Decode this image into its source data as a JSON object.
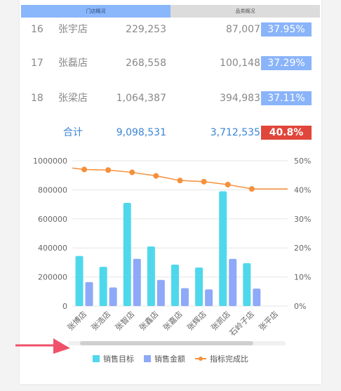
{
  "tabs": [
    "门店概况",
    "品类概况"
  ],
  "rows": [
    {
      "rank": "16",
      "name": "张宇店",
      "target": "229,253",
      "amount": "87,007",
      "pct": "37.95%"
    },
    {
      "rank": "17",
      "name": "张磊店",
      "target": "268,558",
      "amount": "100,148",
      "pct": "37.29%"
    },
    {
      "rank": "18",
      "name": "张梁店",
      "target": "1,064,387",
      "amount": "394,983",
      "pct": "37.11%"
    }
  ],
  "total": {
    "label": "合计",
    "target": "9,098,531",
    "amount": "3,712,535",
    "pct": "40.8%"
  },
  "colors": {
    "target_bar": "#4fd8ec",
    "amount_bar": "#8ea9f8",
    "line": "#f5903b",
    "pct_badge": "#8ab4fa",
    "total_badge": "#e0463a"
  },
  "chart_data": {
    "type": "bar",
    "categories": [
      "张博店",
      "张浩店",
      "张智店",
      "张鑫店",
      "张嘉店",
      "张辉店",
      "张凯店",
      "石岭子店",
      "张平店"
    ],
    "series": [
      {
        "name": "销售目标",
        "type": "bar",
        "axis": "left",
        "values": [
          345000,
          270000,
          710000,
          410000,
          285000,
          265000,
          790000,
          295000,
          null
        ]
      },
      {
        "name": "销售金额",
        "type": "bar",
        "axis": "left",
        "values": [
          165000,
          128000,
          325000,
          180000,
          123000,
          115000,
          325000,
          120000,
          null
        ]
      },
      {
        "name": "指标完成比",
        "type": "line",
        "axis": "right",
        "values": [
          47.0,
          46.8,
          46.0,
          44.8,
          43.2,
          42.8,
          41.8,
          40.3,
          null
        ]
      }
    ],
    "y_left": {
      "ticks": [
        "1000000",
        "800000",
        "600000",
        "400000",
        "200000",
        "0"
      ],
      "range": [
        0,
        1000000
      ]
    },
    "y_right": {
      "ticks": [
        "50%",
        "40%",
        "30%",
        "20%",
        "10%",
        "0%"
      ],
      "range": [
        0,
        50
      ]
    },
    "grid": "horizontal",
    "legend_position": "bottom-center"
  }
}
